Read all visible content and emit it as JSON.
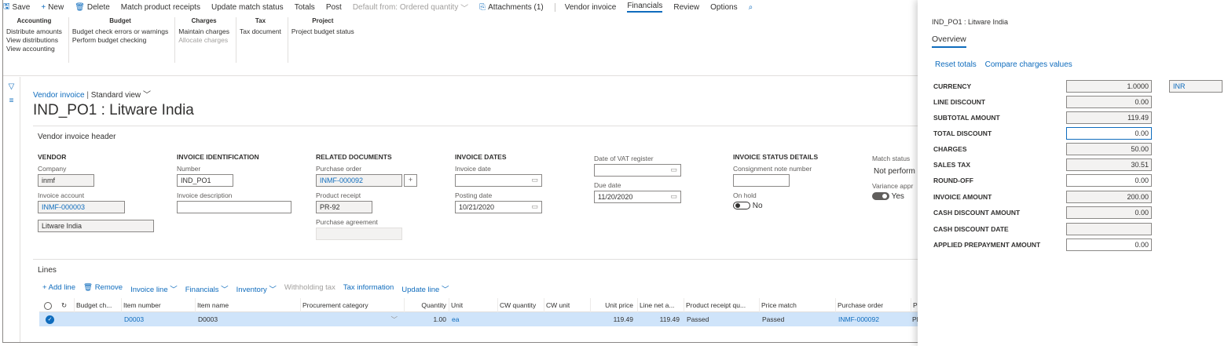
{
  "actionbar": {
    "items": [
      {
        "icon": "save-icon",
        "glyph": "🖫",
        "label": "Save"
      },
      {
        "icon": "plus-icon",
        "glyph": "+",
        "label": "New"
      },
      {
        "icon": "delete-icon",
        "glyph": "🗑",
        "label": "Delete"
      },
      {
        "label": "Match product receipts"
      },
      {
        "label": "Update match status"
      },
      {
        "label": "Totals"
      },
      {
        "label": "Post"
      },
      {
        "label": "Default from: Ordered quantity",
        "caret": "﹀"
      },
      {
        "icon": "attachment-icon",
        "glyph": "⎘",
        "label": "Attachments (1)"
      },
      {
        "label": "Vendor invoice"
      },
      {
        "label": "Financials"
      },
      {
        "label": "Review"
      },
      {
        "label": "Options"
      }
    ]
  },
  "ribbon": {
    "accounting": {
      "title": "Accounting",
      "items": [
        "Distribute amounts",
        "View distributions",
        "View accounting"
      ]
    },
    "budget": {
      "title": "Budget",
      "items": [
        "Budget check errors or warnings",
        "Perform budget checking"
      ]
    },
    "charges": {
      "title": "Charges",
      "items": [
        "Maintain charges",
        "Allocate charges"
      ]
    },
    "tax": {
      "title": "Tax",
      "items": [
        "Tax document"
      ]
    },
    "project": {
      "title": "Project",
      "items": [
        "Project budget status"
      ]
    }
  },
  "breadcrumb": {
    "link": "Vendor invoice",
    "separator": "|",
    "view": "Standard view"
  },
  "page_title": "IND_PO1 : Litware India",
  "header": {
    "title": "Vendor invoice header",
    "vendor": {
      "title": "VENDOR",
      "company_label": "Company",
      "company": "inmf",
      "account_label": "Invoice account",
      "account": "INMF-000003",
      "name": "Litware India"
    },
    "identification": {
      "title": "INVOICE IDENTIFICATION",
      "number_label": "Number",
      "number": "IND_PO1",
      "description_label": "Invoice description",
      "description": ""
    },
    "related": {
      "title": "RELATED DOCUMENTS",
      "po_label": "Purchase order",
      "po": "INMF-000092",
      "receipt_label": "Product receipt",
      "receipt": "PR-92",
      "agreement_label": "Purchase agreement",
      "agreement": ""
    },
    "dates": {
      "title": "INVOICE DATES",
      "invoice_date_label": "Invoice date",
      "invoice_date": "",
      "posting_date_label": "Posting date",
      "posting_date": "10/21/2020"
    },
    "vat": {
      "vat_label": "Date of VAT register",
      "vat": "",
      "due_label": "Due date",
      "due": "11/20/2020"
    },
    "status": {
      "title": "INVOICE STATUS DETAILS",
      "consignment_label": "Consignment note number",
      "consignment": "",
      "onhold_label": "On hold",
      "onhold": "No"
    },
    "match": {
      "match_label": "Match status",
      "match": "Not perform",
      "variance_label": "Variance appr",
      "variance": "Yes"
    }
  },
  "lines": {
    "title": "Lines",
    "toolbar": [
      {
        "label": "+ Add line",
        "enabled": true
      },
      {
        "label": "🗑 Remove",
        "enabled": true
      },
      {
        "label": "Invoice line ﹀",
        "enabled": true
      },
      {
        "label": "Financials ﹀",
        "enabled": true
      },
      {
        "label": "Inventory ﹀",
        "enabled": true
      },
      {
        "label": "Withholding tax",
        "enabled": false
      },
      {
        "label": "Tax information",
        "enabled": true
      },
      {
        "label": "Update line ﹀",
        "enabled": true
      }
    ],
    "columns": [
      "",
      "",
      "Budget ch...",
      "Item number",
      "Item name",
      "Procurement category",
      "Quantity",
      "Unit",
      "CW quantity",
      "CW unit",
      "Unit price",
      "Line net a...",
      "Product receipt qu...",
      "Price match",
      "Purchase order",
      "Pro"
    ],
    "rows": [
      {
        "budget": "",
        "item_number": "D0003",
        "item_name": "D0003",
        "category": "",
        "quantity": "1.00",
        "unit": "ea",
        "cw_quantity": "",
        "cw_unit": "",
        "unit_price": "119.49",
        "line_net": "119.49",
        "receipt_qty": "Passed",
        "price_match": "Passed",
        "purchase_order": "INMF-000092",
        "pro": "PR"
      }
    ]
  },
  "pane": {
    "title": "IND_PO1 : Litware India",
    "tab": "Overview",
    "actions": [
      "Reset totals",
      "Compare charges values"
    ],
    "totals": [
      {
        "label": "CURRENCY",
        "value": "1.0000",
        "currency": "INR"
      },
      {
        "label": "LINE DISCOUNT",
        "value": "0.00"
      },
      {
        "label": "SUBTOTAL AMOUNT",
        "value": "119.49"
      },
      {
        "label": "TOTAL DISCOUNT",
        "value": "0.00"
      },
      {
        "label": "CHARGES",
        "value": "50.00"
      },
      {
        "label": "SALES TAX",
        "value": "30.51"
      },
      {
        "label": "ROUND-OFF",
        "value": "0.00"
      },
      {
        "label": "INVOICE AMOUNT",
        "value": "200.00"
      },
      {
        "label": "CASH DISCOUNT AMOUNT",
        "value": "0.00"
      },
      {
        "label": "CASH DISCOUNT DATE",
        "value": ""
      },
      {
        "label": "APPLIED PREPAYMENT AMOUNT",
        "value": "0.00"
      }
    ]
  },
  "colors": {
    "accent": "#0f6cbd",
    "selected_row": "#cfe4fa"
  }
}
